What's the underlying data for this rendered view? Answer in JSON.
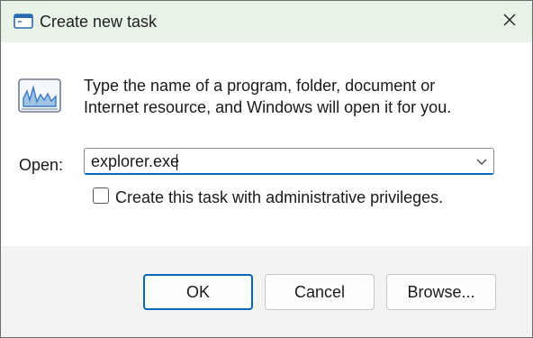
{
  "window": {
    "title": "Create new task",
    "title_icon": "run-icon",
    "close_icon": "close-icon"
  },
  "body": {
    "app_icon": "task-manager-icon",
    "description_line1": "Type the name of a program, folder, document or",
    "description_line2": "Internet resource, and Windows will open it for you.",
    "open_label": "Open:",
    "open_value": "explorer.exe",
    "checkbox_label": "Create this task with administrative privileges.",
    "checkbox_checked": false
  },
  "buttons": {
    "ok": "OK",
    "cancel": "Cancel",
    "browse": "Browse..."
  },
  "colors": {
    "titlebar_bg": "#e8f3e8",
    "accent": "#0067c0",
    "content_bg": "#ffffff",
    "footer_bg": "#f3f3f3"
  }
}
